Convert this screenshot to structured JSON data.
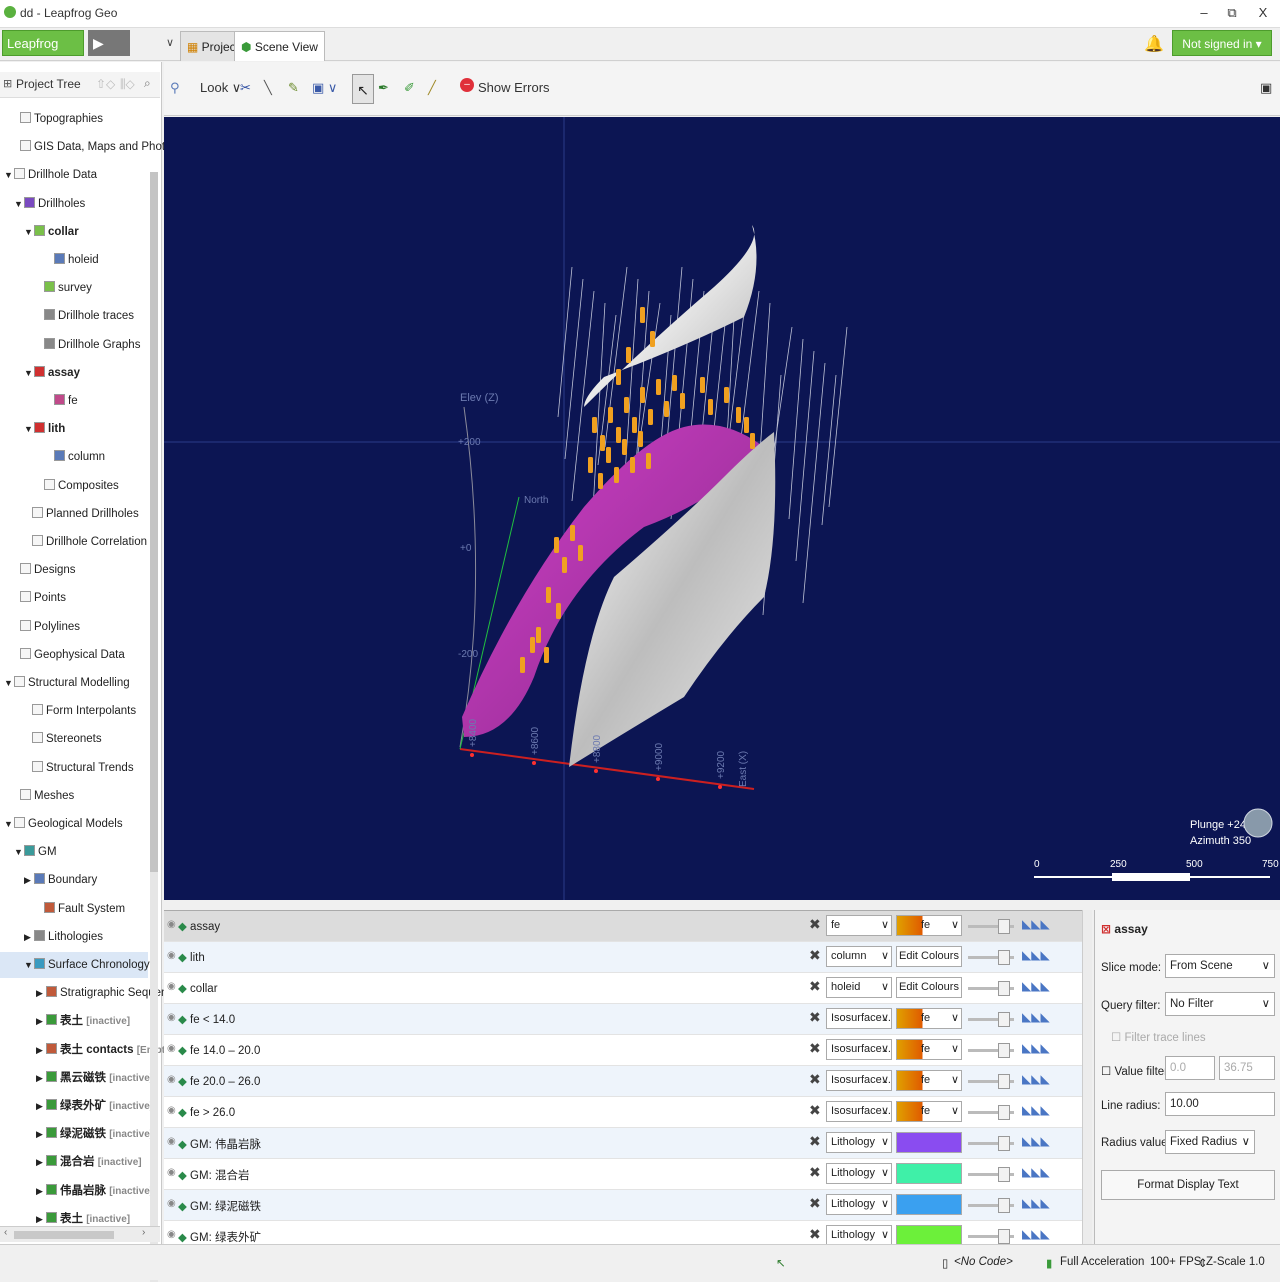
{
  "window": {
    "title": "dd - Leapfrog Geo",
    "minimize": "–",
    "maximize": "⧉",
    "close": "X"
  },
  "menu": {
    "brand": "Leapfrog Geo ▾",
    "play": "▶",
    "chevron": "∨",
    "tabs": [
      {
        "label": "Projects"
      },
      {
        "label": "Scene View"
      }
    ],
    "bell": "🔔",
    "signin": "Not signed in ▾"
  },
  "tree": {
    "title": "Project Tree",
    "items": [
      {
        "label": "Topographies"
      },
      {
        "label": "GIS Data, Maps and Photos"
      },
      {
        "label": "Drillhole Data"
      },
      {
        "label": "Drillholes"
      },
      {
        "label": "collar"
      },
      {
        "label": "holeid"
      },
      {
        "label": "survey"
      },
      {
        "label": "Drillhole traces"
      },
      {
        "label": "Drillhole Graphs"
      },
      {
        "label": "assay"
      },
      {
        "label": "fe"
      },
      {
        "label": "lith"
      },
      {
        "label": "column"
      },
      {
        "label": "Composites"
      },
      {
        "label": "Planned Drillholes"
      },
      {
        "label": "Drillhole Correlation"
      },
      {
        "label": "Designs"
      },
      {
        "label": "Points"
      },
      {
        "label": "Polylines"
      },
      {
        "label": "Geophysical Data"
      },
      {
        "label": "Structural Modelling"
      },
      {
        "label": "Form Interpolants"
      },
      {
        "label": "Stereonets"
      },
      {
        "label": "Structural Trends"
      },
      {
        "label": "Meshes"
      },
      {
        "label": "Geological Models"
      },
      {
        "label": "GM"
      },
      {
        "label": "Boundary"
      },
      {
        "label": "Fault System"
      },
      {
        "label": "Lithologies"
      },
      {
        "label": "Surface Chronology"
      },
      {
        "label": "Stratigraphic Sequence"
      },
      {
        "label": "表土",
        "tag": "[inactive]"
      },
      {
        "label": "表土 contacts",
        "tag": "[Empty]"
      },
      {
        "label": "黑云磁铁",
        "tag": "[inactive]"
      },
      {
        "label": "绿表外矿",
        "tag": "[inactive]"
      },
      {
        "label": "绿泥磁铁",
        "tag": "[inactive]"
      },
      {
        "label": "混合岩",
        "tag": "[inactive]"
      },
      {
        "label": "伟晶岩脉",
        "tag": "[inactive]"
      },
      {
        "label": "表土",
        "tag": "[inactive]"
      }
    ]
  },
  "toolbar": {
    "look": "Look ∨",
    "show_errors": "Show Errors"
  },
  "scene": {
    "elev_label": "Elev (Z)",
    "elev_ticks": [
      "+200",
      "+0",
      "-200"
    ],
    "north_label": "North",
    "east_label": "East (X)",
    "east_ticks": [
      "+8400",
      "+8600",
      "+8800",
      "+9000",
      "+9200"
    ],
    "plunge": "Plunge +24",
    "azimuth": "Azimuth 350",
    "scale_ticks": [
      "0",
      "250",
      "500",
      "750"
    ]
  },
  "layers": [
    {
      "name": "assay",
      "column": "fe",
      "colour": "fe"
    },
    {
      "name": "lith",
      "column": "column",
      "colour": "Edit Colours"
    },
    {
      "name": "collar",
      "column": "holeid",
      "colour": "Edit Colours"
    },
    {
      "name": "fe < 14.0",
      "column": "Isosurface...",
      "colour": "fe"
    },
    {
      "name": "fe 14.0 – 20.0",
      "column": "Isosurface...",
      "colour": "fe"
    },
    {
      "name": "fe 20.0 – 26.0",
      "column": "Isosurface...",
      "colour": "fe"
    },
    {
      "name": "fe > 26.0",
      "column": "Isosurface...",
      "colour": "fe"
    },
    {
      "name": "GM: 伟晶岩脉",
      "column": "Lithology",
      "swatch": "#8a4cf0"
    },
    {
      "name": "GM: 混合岩",
      "column": "Lithology",
      "swatch": "#3ff0a8"
    },
    {
      "name": "GM: 绿泥磁铁",
      "column": "Lithology",
      "swatch": "#3aa0f0"
    },
    {
      "name": "GM: 绿表外矿",
      "column": "Lithology",
      "swatch": "#6cf03a"
    }
  ],
  "props": {
    "title": "assay",
    "slice_mode_label": "Slice mode:",
    "slice_mode": "From Scene",
    "query_filter_label": "Query filter:",
    "query_filter": "No Filter",
    "filter_trace": "Filter trace lines",
    "value_filter_label": "Value filter:",
    "value_min": "0.0",
    "value_max": "36.75",
    "line_radius_label": "Line radius:",
    "line_radius": "10.00",
    "radius_values_label": "Radius values:",
    "radius_values": "Fixed Radius",
    "format_button": "Format Display Text"
  },
  "status": {
    "code": "<No Code>",
    "accel": "Full Acceleration",
    "fps": "100+ FPS",
    "zscale": "Z-Scale 1.0"
  },
  "colors": {
    "brand": "#6cbf45",
    "viewport": "#0c1553",
    "magenta": "#c838c0",
    "orange": "#f0a020"
  }
}
